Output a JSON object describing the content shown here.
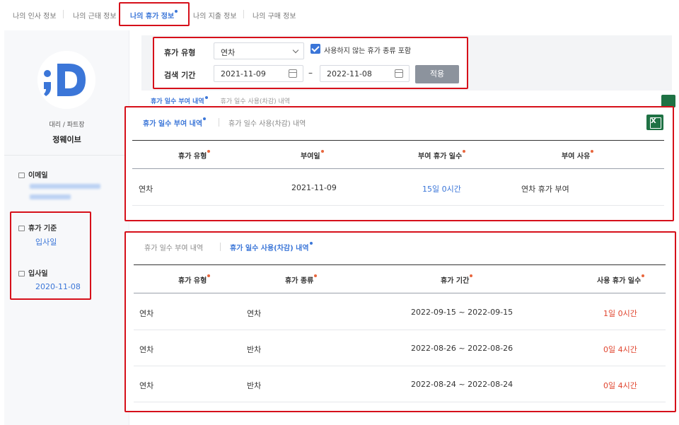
{
  "top_tabs": [
    {
      "label": "나의 인사 정보",
      "active": false
    },
    {
      "label": "나의 근태 정보",
      "active": false
    },
    {
      "label": "나의 휴가 정보",
      "active": true
    },
    {
      "label": "나의 지출 정보",
      "active": false
    },
    {
      "label": "나의 구매 정보",
      "active": false
    }
  ],
  "profile": {
    "role": "대리 / 파트장",
    "name": "정웨이브",
    "email_label": "이메일",
    "leave_basis_label": "휴가 기준",
    "leave_basis_value": "입사일",
    "join_date_label": "입사일",
    "join_date_value": "2020-11-08"
  },
  "filter": {
    "leave_type_label": "휴가 유형",
    "leave_type_value": "연차",
    "include_unused_label": "사용하지 않는 휴가 종류 포함",
    "include_unused_checked": true,
    "period_label": "검색 기간",
    "start_date": "2021-11-09",
    "separator": "–",
    "end_date": "2022-11-08",
    "apply_label": "적용"
  },
  "sub_tabs": {
    "grant": "휴가 일수 부여 내역",
    "usage": "휴가 일수 사용(차감) 내역"
  },
  "grant_table": {
    "headers": [
      "휴가 유형",
      "부여일",
      "부여 휴가 일수",
      "부여 사유"
    ],
    "rows": [
      {
        "type": "연차",
        "date": "2021-11-09",
        "days": "15일 0시간",
        "reason": "연차 휴가 부여"
      }
    ]
  },
  "usage_table": {
    "headers": [
      "휴가 유형",
      "휴가 종류",
      "휴가 기간",
      "사용 휴가 일수"
    ],
    "rows": [
      {
        "type": "연차",
        "kind": "연차",
        "period": "2022-09-15 ~ 2022-09-15",
        "days": "1일 0시간"
      },
      {
        "type": "연차",
        "kind": "반차",
        "period": "2022-08-26 ~ 2022-08-26",
        "days": "0일 4시간"
      },
      {
        "type": "연차",
        "kind": "반차",
        "period": "2022-08-24 ~ 2022-08-24",
        "days": "0일 4시간"
      }
    ]
  },
  "colors": {
    "accent": "#3b76d8",
    "highlight_box": "#d6101a",
    "used_days": "#e0452f",
    "excel": "#1f7244"
  }
}
